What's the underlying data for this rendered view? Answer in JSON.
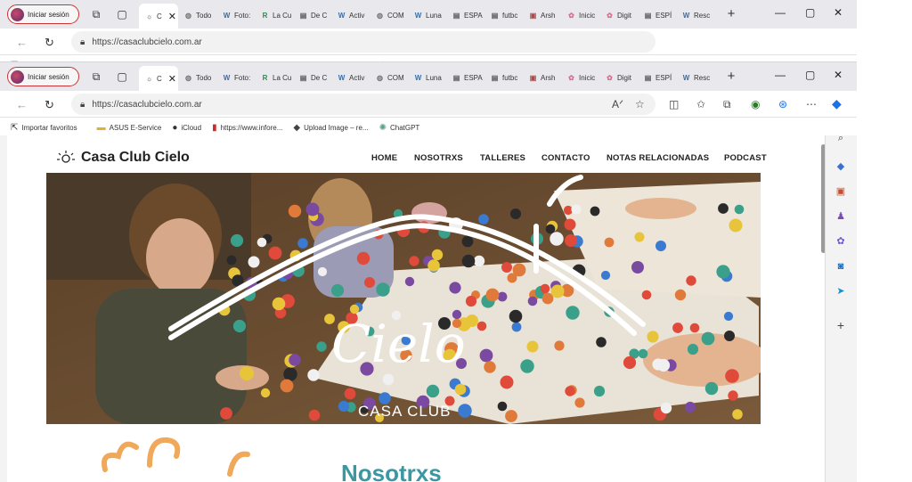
{
  "browser": {
    "profile_label": "Iniciar sesión",
    "tabs": [
      {
        "label": "Todo",
        "icon": "globe-icon"
      },
      {
        "label": "Foto:",
        "icon": "wordpress-icon"
      },
      {
        "label": "La Cu",
        "icon": "r-icon"
      },
      {
        "label": "De C",
        "icon": "doc-icon"
      },
      {
        "label": "Activ",
        "icon": "wordpress-icon"
      },
      {
        "label": "COM",
        "icon": "globe-icon"
      },
      {
        "label": "Luna",
        "icon": "wordpress-icon"
      },
      {
        "label": "ESPA",
        "icon": "doc-icon"
      },
      {
        "label": "futbc",
        "icon": "doc-icon"
      },
      {
        "label": "Arsh",
        "icon": "image-icon"
      },
      {
        "label": "Inicic",
        "icon": "flower-icon"
      },
      {
        "label": "Digit",
        "icon": "flower-icon"
      },
      {
        "label": "ESPÍ",
        "icon": "doc-icon"
      },
      {
        "label": "Resc",
        "icon": "wordpress-icon"
      }
    ],
    "back_tabs_extra": [
      "Inicic",
      "Digit",
      "ESPÍ",
      "Resc"
    ],
    "active_tab": {
      "label": "C",
      "icon": "sun-icon"
    },
    "url": "https://casaclubcielo.com.ar",
    "bookmarks": [
      {
        "label": "Importar favoritos",
        "icon": "import-icon"
      },
      {
        "label": "ASUS E-Service",
        "icon": "folder-icon"
      },
      {
        "label": "iCloud",
        "icon": "apple-icon"
      },
      {
        "label": "https://www.infore...",
        "icon": "bookmark-icon"
      },
      {
        "label": "Upload Image – re...",
        "icon": "layers-icon"
      },
      {
        "label": "ChatGPT",
        "icon": "chatgpt-icon"
      }
    ]
  },
  "site": {
    "brand": "Casa Club Cielo",
    "menu": [
      "HOME",
      "NOSOTRXS",
      "TALLERES",
      "CONTACTO",
      "NOTAS RELACIONADAS",
      "PODCAST"
    ],
    "hero_logo_script": "Cielo",
    "hero_logo_caption": "CASA CLUB",
    "section_title": "Nosotrxs"
  },
  "colors": {
    "accent": "#3b98a3",
    "profile_ring": "#cc3333"
  }
}
